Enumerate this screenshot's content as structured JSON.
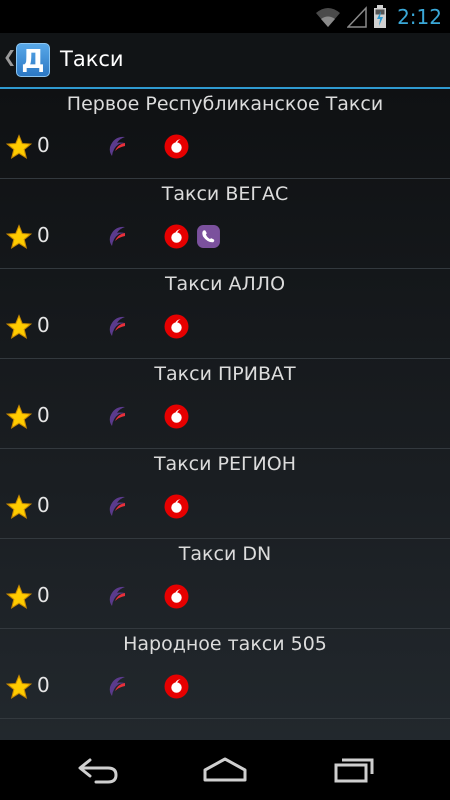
{
  "status_bar": {
    "time": "2:12",
    "icons": [
      "wifi-icon",
      "signal-icon",
      "battery-charging-icon"
    ]
  },
  "action_bar": {
    "title": "Такси",
    "app_icon_letter": "Д"
  },
  "taxi_list": [
    {
      "name": "Первое Республиканское Такси",
      "rating": "0",
      "operators": [
        "kyivstar",
        "vodafone"
      ]
    },
    {
      "name": "Такси ВЕГАС",
      "rating": "0",
      "operators": [
        "kyivstar",
        "vodafone",
        "viber"
      ]
    },
    {
      "name": "Такси АЛЛО",
      "rating": "0",
      "operators": [
        "kyivstar",
        "vodafone"
      ]
    },
    {
      "name": "Такси ПРИВАТ",
      "rating": "0",
      "operators": [
        "kyivstar",
        "vodafone"
      ]
    },
    {
      "name": "Такси РЕГИОН",
      "rating": "0",
      "operators": [
        "kyivstar",
        "vodafone"
      ]
    },
    {
      "name": "Такси DN",
      "rating": "0",
      "operators": [
        "kyivstar",
        "vodafone"
      ]
    },
    {
      "name": "Народное такси 505",
      "rating": "0",
      "operators": [
        "kyivstar",
        "vodafone"
      ]
    }
  ],
  "colors": {
    "accent": "#2f9ad0",
    "vodafone": "#e60000",
    "viber": "#7b519d",
    "star": "#ffcc00"
  },
  "nav_bar": {
    "icons": [
      "back-icon",
      "home-icon",
      "recent-apps-icon"
    ]
  }
}
